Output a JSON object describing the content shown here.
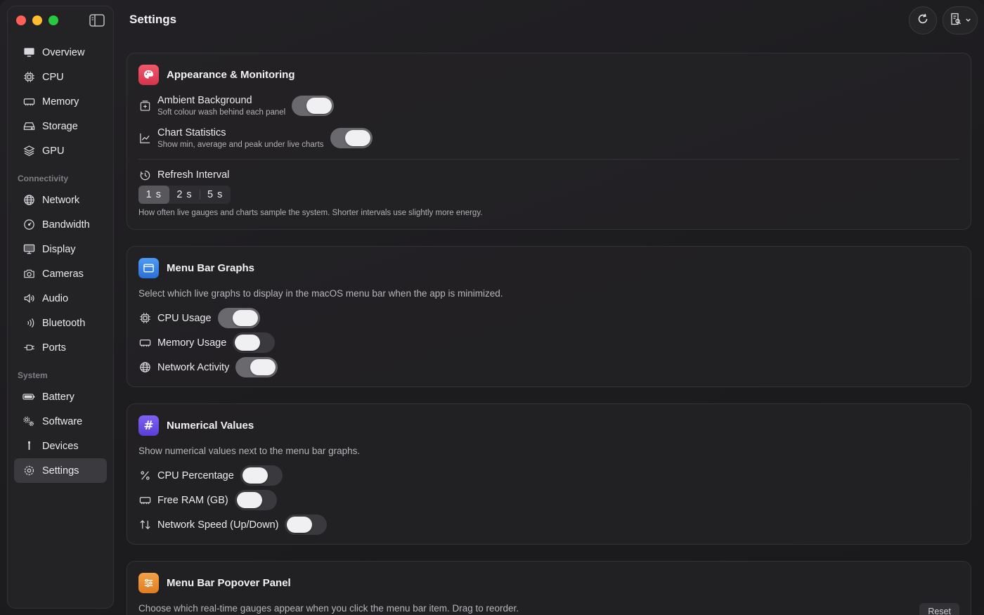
{
  "header": {
    "title": "Settings"
  },
  "sidebar": {
    "items": [
      {
        "id": "overview",
        "label": "Overview",
        "icon": "monitor-icon"
      },
      {
        "id": "cpu",
        "label": "CPU",
        "icon": "chip-icon"
      },
      {
        "id": "memory",
        "label": "Memory",
        "icon": "memory-icon"
      },
      {
        "id": "storage",
        "label": "Storage",
        "icon": "drive-icon"
      },
      {
        "id": "gpu",
        "label": "GPU",
        "icon": "layers-icon"
      }
    ],
    "group_connectivity": "Connectivity",
    "connectivity": [
      {
        "id": "network",
        "label": "Network",
        "icon": "globe-icon"
      },
      {
        "id": "bandwidth",
        "label": "Bandwidth",
        "icon": "gauge-icon"
      },
      {
        "id": "display",
        "label": "Display",
        "icon": "display-icon"
      },
      {
        "id": "cameras",
        "label": "Cameras",
        "icon": "camera-icon"
      },
      {
        "id": "audio",
        "label": "Audio",
        "icon": "speaker-icon"
      },
      {
        "id": "bluetooth",
        "label": "Bluetooth",
        "icon": "bluetooth-waves-icon"
      },
      {
        "id": "ports",
        "label": "Ports",
        "icon": "plug-icon"
      }
    ],
    "group_system": "System",
    "system": [
      {
        "id": "battery",
        "label": "Battery",
        "icon": "battery-icon"
      },
      {
        "id": "software",
        "label": "Software",
        "icon": "gears-icon"
      },
      {
        "id": "devices",
        "label": "Devices",
        "icon": "usb-icon"
      },
      {
        "id": "settings",
        "label": "Settings",
        "icon": "gear-icon",
        "active": true
      }
    ]
  },
  "appearance": {
    "title": "Appearance & Monitoring",
    "ambient": {
      "label": "Ambient Background",
      "sub": "Soft colour wash behind each panel",
      "on": true
    },
    "chart_stats": {
      "label": "Chart Statistics",
      "sub": "Show min, average and peak under live charts",
      "on": true
    },
    "refresh": {
      "label": "Refresh Interval",
      "options": [
        "1 s",
        "2 s",
        "5 s"
      ],
      "selected": "1 s",
      "note": "How often live gauges and charts sample the system. Shorter intervals use slightly more energy."
    }
  },
  "menubar_graphs": {
    "title": "Menu Bar Graphs",
    "desc": "Select which live graphs to display in the macOS menu bar when the app is minimized.",
    "cpu": {
      "label": "CPU Usage",
      "on": true
    },
    "memory": {
      "label": "Memory Usage",
      "on": false
    },
    "network": {
      "label": "Network Activity",
      "on": true
    }
  },
  "numerical": {
    "title": "Numerical Values",
    "desc": "Show numerical values next to the menu bar graphs.",
    "cpu_pct": {
      "label": "CPU Percentage",
      "on": false
    },
    "free_ram": {
      "label": "Free RAM (GB)",
      "on": false
    },
    "net_speed": {
      "label": "Network Speed (Up/Down)",
      "on": false
    }
  },
  "popover": {
    "title": "Menu Bar Popover Panel",
    "desc": "Choose which real-time gauges appear when you click the menu bar item. Drag to reorder.",
    "reset_label": "Reset"
  },
  "colors": {
    "appearance_icon": "#e0405a",
    "graphs_icon": "#2f7fe6",
    "numerical_icon": "#6b4de6",
    "popover_icon": "#e8892a"
  }
}
